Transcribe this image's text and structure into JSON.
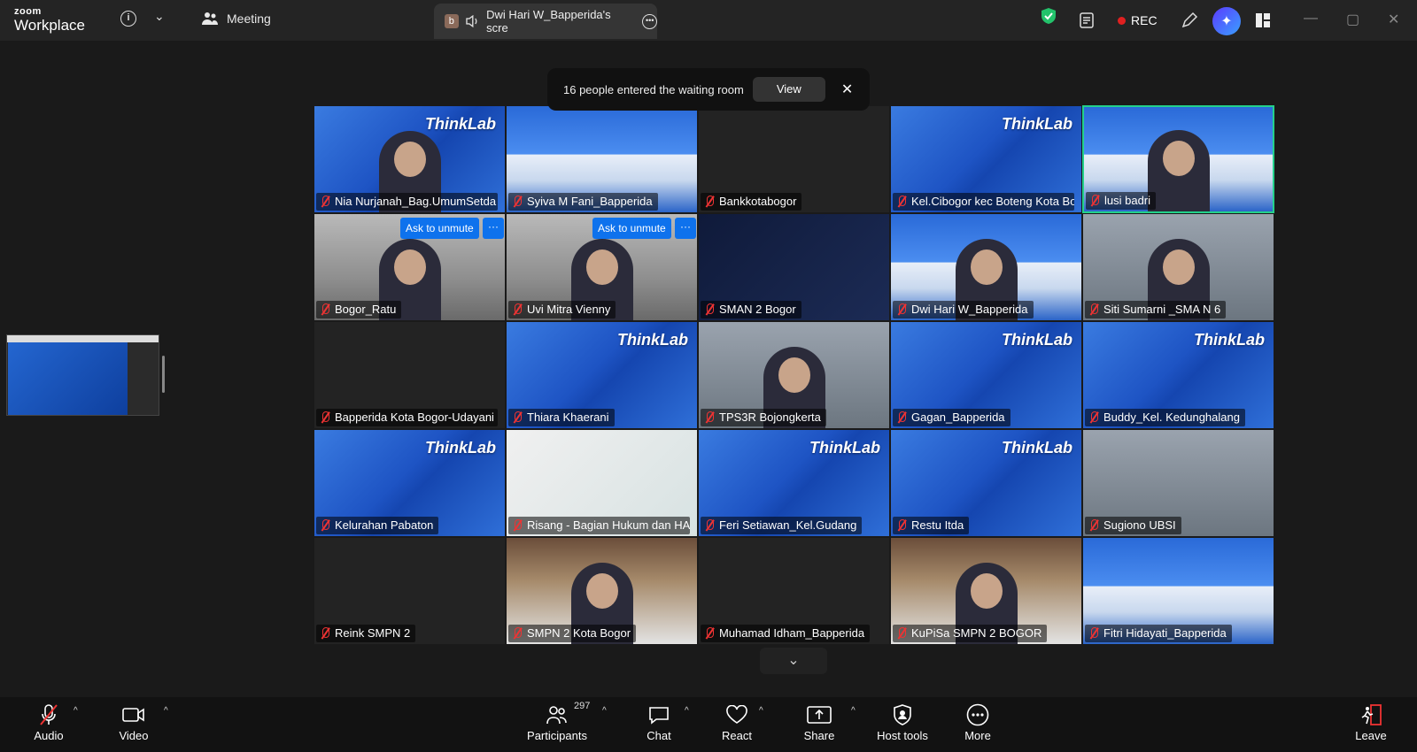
{
  "app": {
    "logo_line1": "zoom",
    "logo_line2": "Workplace",
    "meeting_label": "Meeting",
    "share_tab_badge": "b",
    "share_tab_title": "Dwi Hari W_Bapperida's scre",
    "rec_label": "REC"
  },
  "notification": {
    "text": "16 people entered the waiting room",
    "view_label": "View",
    "close_glyph": "✕"
  },
  "grid": {
    "ask_unmute_label": "Ask to unmute",
    "more_glyph": "···",
    "tiles": [
      {
        "name": "Nia Nurjanah_Bag.UmumSetda",
        "bg": "bg-blue",
        "logo": "ThinkLab",
        "person": true
      },
      {
        "name": "Syiva M Fani_Bapperida",
        "bg": "bg-bldg"
      },
      {
        "name": "Bankkotabogor",
        "bg": ""
      },
      {
        "name": "Kel.Cibogor kec Boteng Kota Bo...",
        "bg": "bg-blue",
        "logo": "ThinkLab"
      },
      {
        "name": "lusi badri",
        "bg": "bg-bldg",
        "person": true,
        "speaking": true
      },
      {
        "name": "Bogor_Ratu",
        "bg": "bg-room",
        "person": true,
        "ask": true
      },
      {
        "name": "Uvi Mitra Vienny",
        "bg": "bg-room",
        "person": true,
        "ask": true
      },
      {
        "name": "SMAN 2 Bogor",
        "bg": "bg-dark"
      },
      {
        "name": "Dwi Hari W_Bapperida",
        "bg": "bg-bldg",
        "person": true
      },
      {
        "name": "Siti Sumarni _SMA N 6",
        "bg": "bg-photo",
        "person": true
      },
      {
        "name": "Bapperida Kota Bogor-Udayani",
        "bg": ""
      },
      {
        "name": "Thiara Khaerani",
        "bg": "bg-blue",
        "logo": "ThinkLab"
      },
      {
        "name": "TPS3R Bojongkerta",
        "bg": "bg-photo",
        "person": true
      },
      {
        "name": "Gagan_Bapperida",
        "bg": "bg-blue",
        "logo": "ThinkLab"
      },
      {
        "name": "Buddy_Kel. Kedunghalang",
        "bg": "bg-blue",
        "logo": "ThinkLab"
      },
      {
        "name": "Kelurahan Pabaton",
        "bg": "bg-blue",
        "logo": "ThinkLab"
      },
      {
        "name": "Risang - Bagian Hukum dan HA...",
        "bg": "bg-white"
      },
      {
        "name": "Feri Setiawan_Kel.Gudang",
        "bg": "bg-blue",
        "logo": "ThinkLab"
      },
      {
        "name": "Restu Itda",
        "bg": "bg-blue",
        "logo": "ThinkLab"
      },
      {
        "name": "Sugiono UBSI",
        "bg": "bg-photo"
      },
      {
        "name": "Reink SMPN 2",
        "bg": ""
      },
      {
        "name": "SMPN 2 Kota Bogor",
        "bg": "bg-shelf",
        "person": true
      },
      {
        "name": "Muhamad Idham_Bapperida",
        "bg": ""
      },
      {
        "name": "KuPiSa SMPN 2 BOGOR",
        "bg": "bg-shelf",
        "person": true
      },
      {
        "name": "Fitri Hidayati_Bapperida",
        "bg": "bg-bldg"
      }
    ]
  },
  "toolbar": {
    "audio": "Audio",
    "video": "Video",
    "participants": "Participants",
    "participants_count": "297",
    "chat": "Chat",
    "react": "React",
    "share": "Share",
    "host_tools": "Host tools",
    "more": "More",
    "leave": "Leave"
  },
  "colors": {
    "accent_blue": "#0e72ed",
    "speaking_green": "#23d18b",
    "muted_red": "#e33333"
  }
}
